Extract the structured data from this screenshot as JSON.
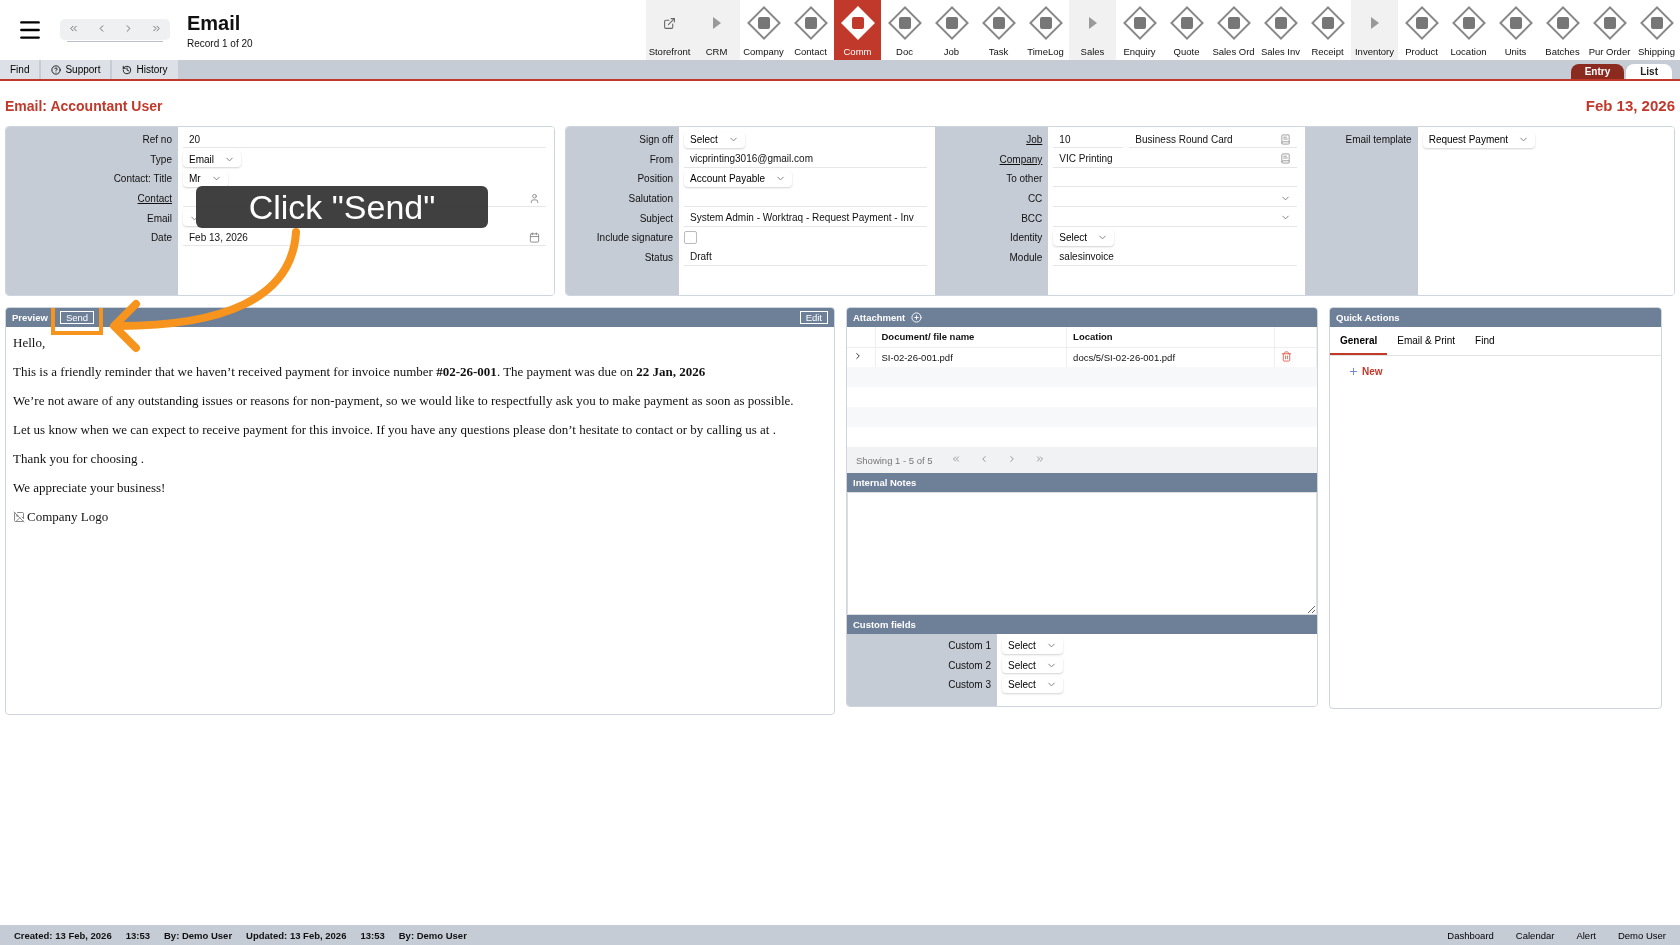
{
  "header": {
    "title": "Email",
    "record": "Record 1 of 20"
  },
  "toolbar": [
    {
      "label": "Storefront",
      "kind": "link",
      "selected": false
    },
    {
      "label": "CRM",
      "kind": "section",
      "selected": false
    },
    {
      "label": "Company",
      "kind": "module",
      "selected": false
    },
    {
      "label": "Contact",
      "kind": "module",
      "selected": false
    },
    {
      "label": "Comm",
      "kind": "module",
      "selected": true
    },
    {
      "label": "Doc",
      "kind": "module",
      "selected": false
    },
    {
      "label": "Job",
      "kind": "module",
      "selected": false
    },
    {
      "label": "Task",
      "kind": "module",
      "selected": false
    },
    {
      "label": "TimeLog",
      "kind": "module",
      "selected": false
    },
    {
      "label": "Sales",
      "kind": "section",
      "selected": false
    },
    {
      "label": "Enquiry",
      "kind": "module",
      "selected": false
    },
    {
      "label": "Quote",
      "kind": "module",
      "selected": false
    },
    {
      "label": "Sales Ord",
      "kind": "module",
      "selected": false
    },
    {
      "label": "Sales Inv",
      "kind": "module",
      "selected": false
    },
    {
      "label": "Receipt",
      "kind": "module",
      "selected": false
    },
    {
      "label": "Inventory",
      "kind": "section",
      "selected": false
    },
    {
      "label": "Product",
      "kind": "module",
      "selected": false
    },
    {
      "label": "Location",
      "kind": "module",
      "selected": false
    },
    {
      "label": "Units",
      "kind": "module",
      "selected": false
    },
    {
      "label": "Batches",
      "kind": "module",
      "selected": false
    },
    {
      "label": "Pur Order",
      "kind": "module",
      "selected": false
    },
    {
      "label": "Shipping",
      "kind": "module",
      "selected": false
    }
  ],
  "menu": [
    {
      "label": "Find",
      "kind": "plain"
    },
    {
      "label": "Support",
      "kind": "help"
    },
    {
      "label": "History",
      "kind": "history"
    }
  ],
  "view_tabs": [
    {
      "label": "Entry",
      "selected": true
    },
    {
      "label": "List",
      "selected": false
    }
  ],
  "page": {
    "title": "Email: Accountant User",
    "date": "Feb 13, 2026"
  },
  "form_groups": [
    {
      "fields": [
        {
          "label": "Ref no",
          "kind": "text",
          "link": false,
          "value": "20"
        },
        {
          "label": "Type",
          "kind": "select",
          "link": false,
          "value": "Email"
        },
        {
          "label": "Contact: Title",
          "kind": "select",
          "link": false,
          "value": "Mr"
        },
        {
          "label": "Contact",
          "kind": "person",
          "link": true
        },
        {
          "label": "Email",
          "kind": "select",
          "link": false
        },
        {
          "label": "Date",
          "kind": "date",
          "link": false,
          "value": "Feb 13, 2026"
        }
      ]
    },
    {
      "fields": [
        {
          "label": "Sign off",
          "kind": "select",
          "link": false,
          "value": "Select"
        },
        {
          "label": "From",
          "kind": "text",
          "link": false,
          "value": "vicprinting3016@gmail.com"
        },
        {
          "label": "Position",
          "kind": "select",
          "link": false,
          "value": "Account Payable"
        },
        {
          "label": "Salutation",
          "kind": "text",
          "link": false
        },
        {
          "label": "Subject",
          "kind": "text",
          "link": false,
          "value": "System Admin - Worktraq - Request Payment - Inv"
        },
        {
          "label": "Include signature",
          "kind": "checkbox",
          "link": false,
          "checked": false
        },
        {
          "label": "Status",
          "kind": "text",
          "link": false,
          "value": "Draft"
        }
      ]
    },
    {
      "fields": [
        {
          "label": "Job",
          "kind": "pair",
          "link": true,
          "value": "10",
          "value2": "Business Round Card"
        },
        {
          "label": "Company",
          "kind": "record",
          "link": true,
          "value": "VIC Printing"
        },
        {
          "label": "To other",
          "kind": "text",
          "link": false
        },
        {
          "label": "CC",
          "kind": "dropdown",
          "link": false
        },
        {
          "label": "BCC",
          "kind": "dropdown",
          "link": false
        },
        {
          "label": "Identity",
          "kind": "select",
          "link": false,
          "value": "Select"
        },
        {
          "label": "Module",
          "kind": "text",
          "link": false,
          "value": "salesinvoice"
        }
      ]
    },
    {
      "fields": [
        {
          "label": "Email template",
          "kind": "select",
          "link": false,
          "value": "Request Payment"
        }
      ]
    }
  ],
  "preview": {
    "title": "Preview",
    "send": "Send",
    "edit": "Edit",
    "paragraphs": [
      "Hello,",
      "This is a friendly reminder that we haven’t received payment for invoice number **#02-26-001**. The payment was due on **22 Jan, 2026**",
      "We’re not aware of any outstanding issues or reasons for non-payment, so we would like to respectfully ask you to make payment as soon as possible.",
      "Let us know when we can expect to receive payment for this invoice. If you have any questions please don’t hesitate to contact or by calling us at .",
      "Thank you for choosing .",
      "We appreciate your business!"
    ],
    "image_alt": "Company Logo"
  },
  "attachment": {
    "title": "Attachment",
    "columns": [
      "Document/ file name",
      "Location"
    ],
    "rows": [
      {
        "cells": [
          "SI-02-26-001.pdf",
          "docs/5/SI-02-26-001.pdf"
        ]
      }
    ],
    "pager": "Showing 1 - 5 of 5"
  },
  "internal_notes": {
    "title": "Internal Notes"
  },
  "custom_fields": {
    "title": "Custom fields",
    "fields": [
      {
        "label": "Custom 1",
        "value": "Select"
      },
      {
        "label": "Custom 2",
        "value": "Select"
      },
      {
        "label": "Custom 3",
        "value": "Select"
      }
    ]
  },
  "quick_actions": {
    "title": "Quick Actions",
    "tabs": [
      {
        "label": "General",
        "selected": true
      },
      {
        "label": "Email & Print",
        "selected": false
      },
      {
        "label": "Find",
        "selected": false
      }
    ],
    "new": "New"
  },
  "callout": {
    "text": "Click \"Send\""
  },
  "status_bar": {
    "left": [
      "Created: 13 Feb, 2026",
      "13:53",
      "By: Demo User",
      "Updated: 13 Feb, 2026",
      "13:53",
      "By: Demo User"
    ],
    "right": [
      "Dashboard",
      "Calendar",
      "Alert",
      "Demo User"
    ]
  }
}
